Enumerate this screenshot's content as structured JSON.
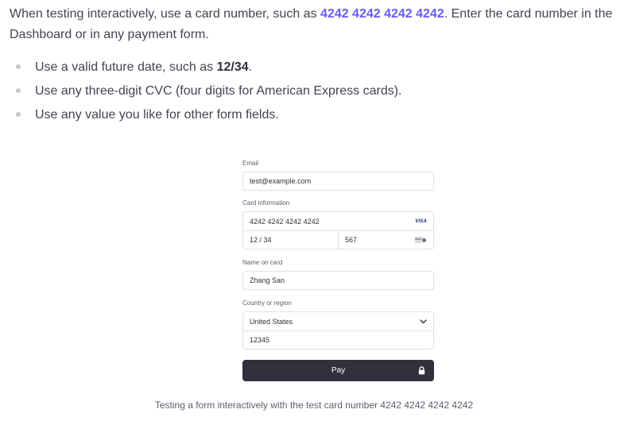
{
  "intro": {
    "before": "When testing interactively, use a card number, such as ",
    "card_number": "4242 4242 4242 4242",
    "after": ". Enter the card number in the Dashboard or in any payment form."
  },
  "bullets": [
    {
      "before": "Use a valid future date, such as ",
      "bold": "12/34",
      "after": "."
    },
    {
      "text": "Use any three-digit CVC (four digits for American Express cards)."
    },
    {
      "text": "Use any value you like for other form fields."
    }
  ],
  "form": {
    "email_label": "Email",
    "email_value": "test@example.com",
    "card_label": "Card information",
    "card_number": "4242 4242 4242 4242",
    "card_brand": "VISA",
    "expiry": "12 / 34",
    "cvc": "567",
    "name_label": "Name on card",
    "name_value": "Zhang San",
    "country_label": "Country or region",
    "country_value": "United States",
    "zip_value": "12345",
    "pay_label": "Pay"
  },
  "icons": {
    "cvc": "cvc-card-icon",
    "chevron": "chevron-down-icon",
    "lock": "lock-icon"
  },
  "colors": {
    "accent": "#635bff",
    "pay_button": "#30313d"
  },
  "caption": "Testing a form interactively with the test card number 4242 4242 4242 4242"
}
